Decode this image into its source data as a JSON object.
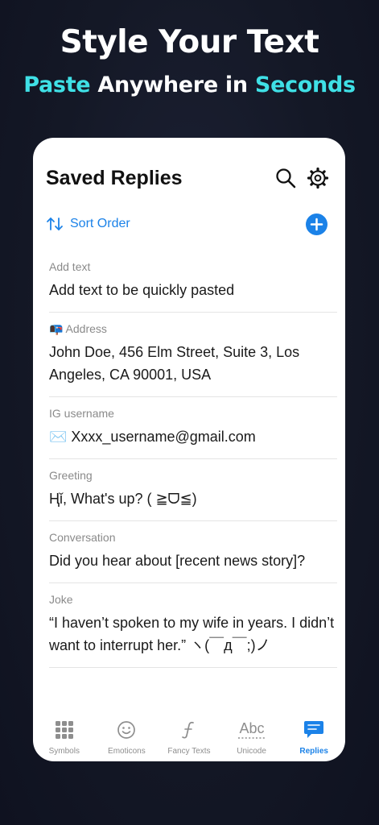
{
  "promo": {
    "title": "Style Your Text",
    "subtitle_part1": "Paste",
    "subtitle_part2": " Anywhere in ",
    "subtitle_part3": "Seconds"
  },
  "header": {
    "title": "Saved Replies",
    "search_icon": "search-icon",
    "settings_icon": "gear-icon"
  },
  "toolbar": {
    "sort_label": "Sort Order",
    "add_icon": "plus-icon"
  },
  "replies": [
    {
      "label": "Add text",
      "text": "Add text to be quickly pasted"
    },
    {
      "label": "📭 Address",
      "text": "John Doe, 456 Elm Street, Suite 3, Los Angeles, CA 90001, USA"
    },
    {
      "label": "IG username",
      "text": "✉️ Xxxx_username@gmail.com"
    },
    {
      "label": "Greeting",
      "text": "Ⱨǐ, What's up? ( ≧ᗜ≦)"
    },
    {
      "label": "Conversation",
      "text": "Did you hear about [recent news story]?"
    },
    {
      "label": "Joke",
      "text": "“I haven’t spoken to my wife in years. I didn’t want to interrupt her.” ヽ(￣д￣;)ノ"
    }
  ],
  "tabs": [
    {
      "label": "Symbols",
      "icon": "grid-icon",
      "active": false
    },
    {
      "label": "Emoticons",
      "icon": "smiley-icon",
      "active": false
    },
    {
      "label": "Fancy Texts",
      "icon": "script-f-icon",
      "active": false
    },
    {
      "label": "Unicode",
      "icon": "abc-icon",
      "active": false
    },
    {
      "label": "Replies",
      "icon": "chat-bubble-icon",
      "active": true
    }
  ],
  "colors": {
    "accent": "#1b82e8",
    "promo_accent": "#3fe0e6",
    "background": "#141826"
  }
}
